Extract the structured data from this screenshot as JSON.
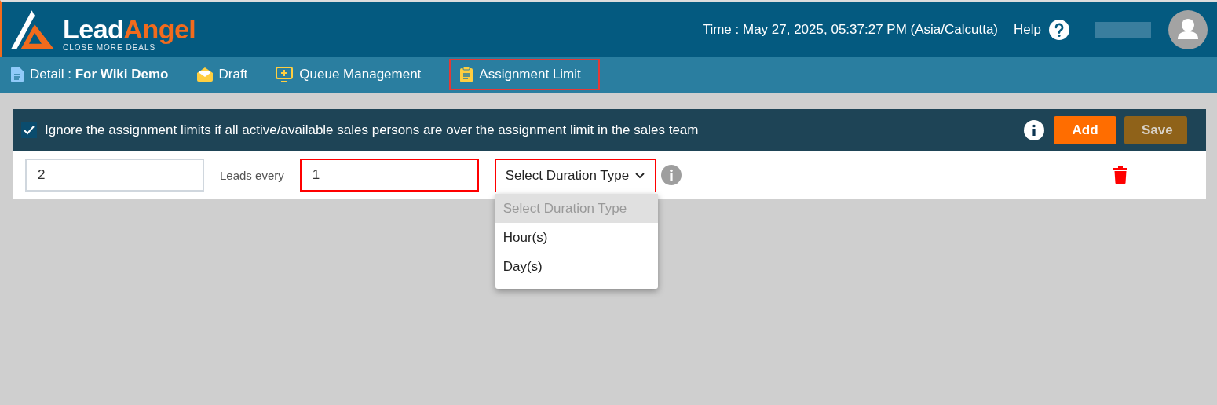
{
  "header": {
    "logo": {
      "name_part1": "Lead",
      "name_part2": "Angel",
      "tagline": "CLOSE MORE DEALS"
    },
    "time": "Time : May 27, 2025, 05:37:27 PM (Asia/Calcutta)",
    "help": "Help"
  },
  "tabs": [
    {
      "kind": "document",
      "label": "Detail : **For Wiki Demo**",
      "selected": false
    },
    {
      "kind": "envelope",
      "label": "Draft",
      "selected": false
    },
    {
      "kind": "monitor",
      "label": "Queue Management",
      "selected": false
    },
    {
      "kind": "clipboard",
      "label": "Assignment Limit",
      "selected": true
    }
  ],
  "settings": {
    "ignore_limits": {
      "label": "Ignore the assignment limits if all active/available sales persons are over the assignment limit in the sales team",
      "checked": true
    },
    "buttons": [
      {
        "kind": "add",
        "label": "Add",
        "disabled": false
      },
      {
        "kind": "save",
        "label": "Save",
        "disabled": true
      }
    ]
  },
  "limit_row": {
    "count": "2",
    "leads_label": "Leads every",
    "interval": "1",
    "duration": {
      "value": "Select Duration Type",
      "expanded": true,
      "options": [
        {
          "label": "Select Duration Type",
          "selected": true
        },
        {
          "label": "Hour(s)",
          "selected": false
        },
        {
          "label": "Day(s)",
          "selected": false
        }
      ]
    }
  }
}
